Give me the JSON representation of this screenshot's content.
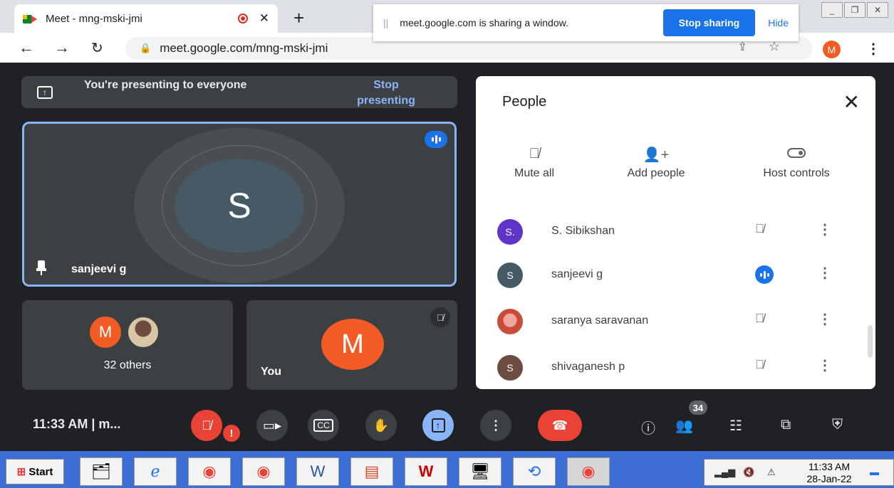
{
  "browser": {
    "tab_title": "Meet - mng-mski-jmi",
    "url": "meet.google.com/mng-mski-jmi",
    "profile_initial": "M"
  },
  "share_bar": {
    "message": "meet.google.com is sharing a window.",
    "stop_label": "Stop sharing",
    "hide_label": "Hide"
  },
  "presenting": {
    "message": "You're presenting to everyone",
    "stop_label": "Stop presenting"
  },
  "main_tile": {
    "initial": "S",
    "name": "sanjeevi g"
  },
  "others_tile": {
    "initial": "M",
    "label": "32 others"
  },
  "you_tile": {
    "initial": "M",
    "label": "You"
  },
  "people_panel": {
    "title": "People",
    "actions": [
      {
        "label": "Mute all",
        "icon": "mic-off-icon"
      },
      {
        "label": "Add people",
        "icon": "add-person-icon"
      },
      {
        "label": "Host controls",
        "icon": "toggle-icon"
      }
    ],
    "participants": [
      {
        "initial": "S.",
        "name": "S. Sibikshan",
        "color": "#5f35c9",
        "status": "muted"
      },
      {
        "initial": "S",
        "name": "sanjeevi g",
        "color": "#455a64",
        "status": "speaking"
      },
      {
        "initial": "",
        "name": "saranya saravanan",
        "color": "#c94c3b",
        "status": "muted"
      },
      {
        "initial": "S",
        "name": "shivaganesh p",
        "color": "#6d4c41",
        "status": "muted"
      }
    ]
  },
  "controls": {
    "clock": "11:33 AM  |  m...",
    "participant_count": "34"
  },
  "taskbar": {
    "start_label": "Start",
    "time": "11:33 AM",
    "date": "28-Jan-22"
  }
}
